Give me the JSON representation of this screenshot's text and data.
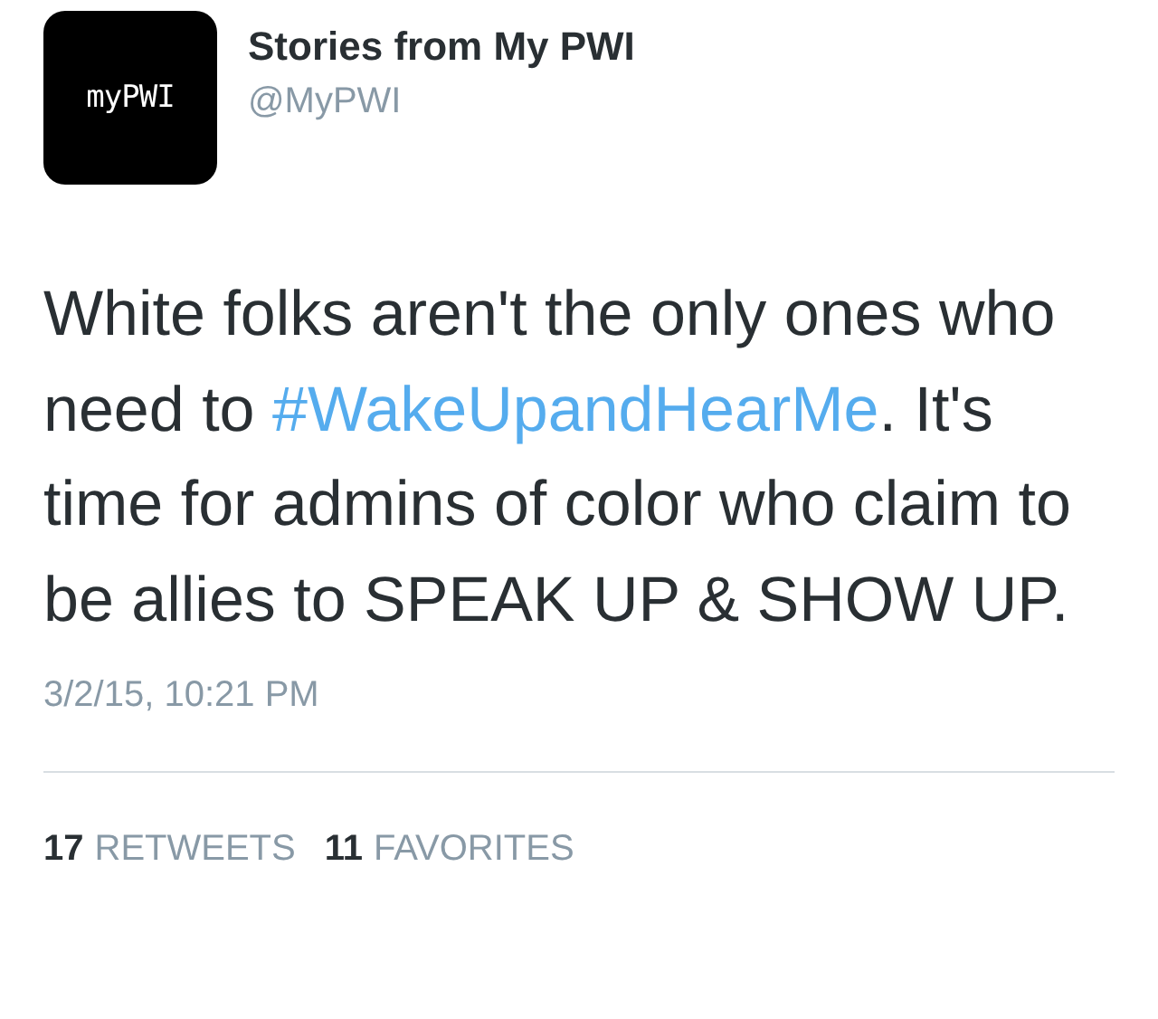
{
  "author": {
    "avatar_text": "myPWI",
    "name": "Stories from My PWI",
    "handle": "@MyPWI"
  },
  "tweet": {
    "parts": [
      {
        "kind": "text",
        "text": "White folks aren't the only ones who need to "
      },
      {
        "kind": "hashtag",
        "text": "#WakeUpandHearMe"
      },
      {
        "kind": "text",
        "text": ". It's time for admins of color who claim to be allies to SPEAK UP & SHOW UP."
      }
    ]
  },
  "timestamp": "3/2/15, 10:21 PM",
  "stats": [
    {
      "count": "17",
      "label": "RETWEETS"
    },
    {
      "count": "11",
      "label": "FAVORITES"
    }
  ]
}
